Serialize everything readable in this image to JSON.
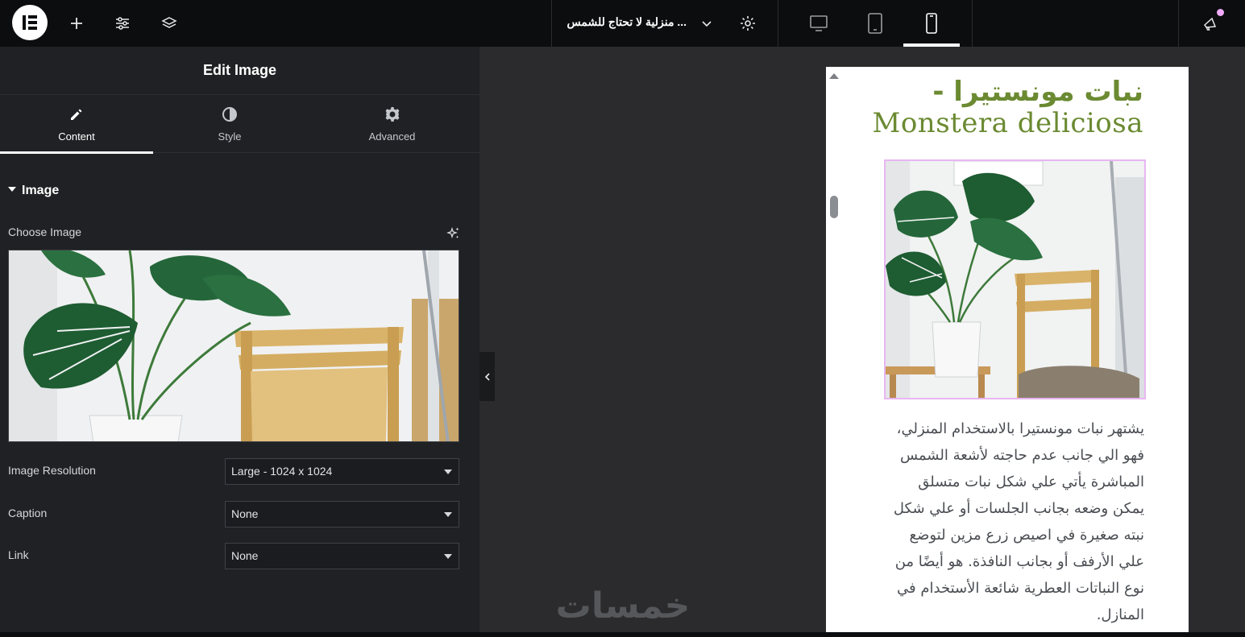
{
  "topbar": {
    "document_title": "... منزلية لا تحتاج للشمس",
    "add_label": "+",
    "devices": [
      "desktop",
      "tablet",
      "mobile"
    ],
    "active_device": "mobile"
  },
  "panel": {
    "title": "Edit Image",
    "tabs": [
      {
        "label": "Content",
        "icon": "pencil-icon",
        "active": true
      },
      {
        "label": "Style",
        "icon": "half-circle-icon",
        "active": false
      },
      {
        "label": "Advanced",
        "icon": "gear-icon",
        "active": false
      }
    ],
    "section_title": "Image",
    "choose_image_label": "Choose Image",
    "fields": {
      "resolution": {
        "label": "Image Resolution",
        "value": "Large - 1024 x 1024"
      },
      "caption": {
        "label": "Caption",
        "value": "None"
      },
      "link": {
        "label": "Link",
        "value": "None"
      }
    }
  },
  "preview": {
    "heading_ar": "نبات مونستيرا -",
    "heading_en": "Monstera deliciosa",
    "paragraph": "يشتهر نبات مونستيرا بالاستخدام المنزلي، فهو الي جانب عدم حاجته لأشعة الشمس المباشرة يأتي علي شكل نبات متسلق يمكن وضعه بجانب الجلسات أو علي شكل نبته صغيرة في اصيص زرع مزين لتوضع علي الأرفف أو بجانب النافذة. هو أيضًا من نوع النباتات العطرية شائعة الأستخدام في المنازل."
  },
  "watermark": "خمسات",
  "colors": {
    "accent_green": "#6b8a32",
    "selection_outline": "#e8b6f2",
    "panel_bg": "#1f2124",
    "topbar_bg": "#0c0d0e"
  }
}
